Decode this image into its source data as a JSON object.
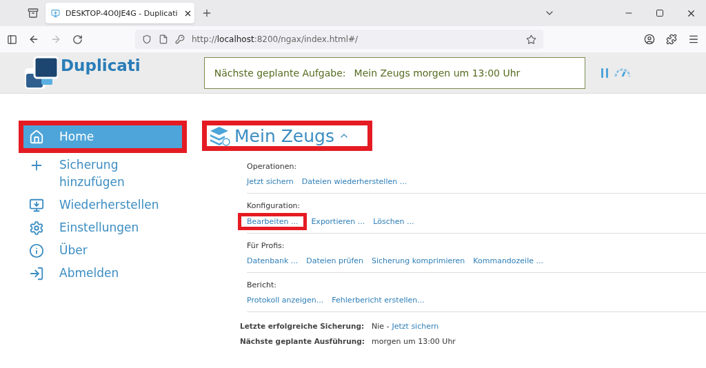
{
  "browser": {
    "tab_title": "DESKTOP-4O0JE4G - Duplicati",
    "url_prefix": "http://",
    "url_host": "localhost",
    "url_rest": ":8200/ngax/index.html#/"
  },
  "header": {
    "logo_text": "Duplicati",
    "next_task_label": "Nächste geplante Aufgabe:",
    "next_task_value": "Mein Zeugs morgen um 13:00 Uhr"
  },
  "sidebar": {
    "items": [
      {
        "kind": "home",
        "label": "Home",
        "selected": true,
        "highlighted": true
      },
      {
        "kind": "add",
        "label": "Sicherung hinzufügen",
        "selected": false,
        "highlighted": false
      },
      {
        "kind": "restore",
        "label": "Wiederherstellen",
        "selected": false,
        "highlighted": false
      },
      {
        "kind": "settings",
        "label": "Einstellungen",
        "selected": false,
        "highlighted": false
      },
      {
        "kind": "about",
        "label": "Über",
        "selected": false,
        "highlighted": false
      },
      {
        "kind": "logout",
        "label": "Abmelden",
        "selected": false,
        "highlighted": false
      }
    ]
  },
  "backup": {
    "title": "Mein Zeugs",
    "title_highlighted": true,
    "expanded": true,
    "sections": [
      {
        "heading": "Operationen:",
        "links": [
          {
            "label": "Jetzt sichern",
            "highlighted": false
          },
          {
            "label": "Dateien wiederherstellen ...",
            "highlighted": false
          }
        ]
      },
      {
        "heading": "Konfiguration:",
        "links": [
          {
            "label": "Bearbeiten ...",
            "highlighted": true
          },
          {
            "label": "Exportieren ...",
            "highlighted": false
          },
          {
            "label": "Löschen ...",
            "highlighted": false
          }
        ]
      },
      {
        "heading": "Für Profis:",
        "links": [
          {
            "label": "Datenbank ...",
            "highlighted": false
          },
          {
            "label": "Dateien prüfen",
            "highlighted": false
          },
          {
            "label": "Sicherung komprimieren",
            "highlighted": false
          },
          {
            "label": "Kommandozeile ...",
            "highlighted": false
          }
        ]
      },
      {
        "heading": "Bericht:",
        "links": [
          {
            "label": "Protokoll anzeigen...",
            "highlighted": false
          },
          {
            "label": "Fehlerbericht erstellen...",
            "highlighted": false
          }
        ]
      }
    ],
    "info": [
      {
        "label": "Letzte erfolgreiche Sicherung:",
        "value": "Nie -",
        "link": "Jetzt sichern"
      },
      {
        "label": "Nächste geplante Ausführung:",
        "value": "morgen um 13:00 Uhr"
      }
    ]
  }
}
